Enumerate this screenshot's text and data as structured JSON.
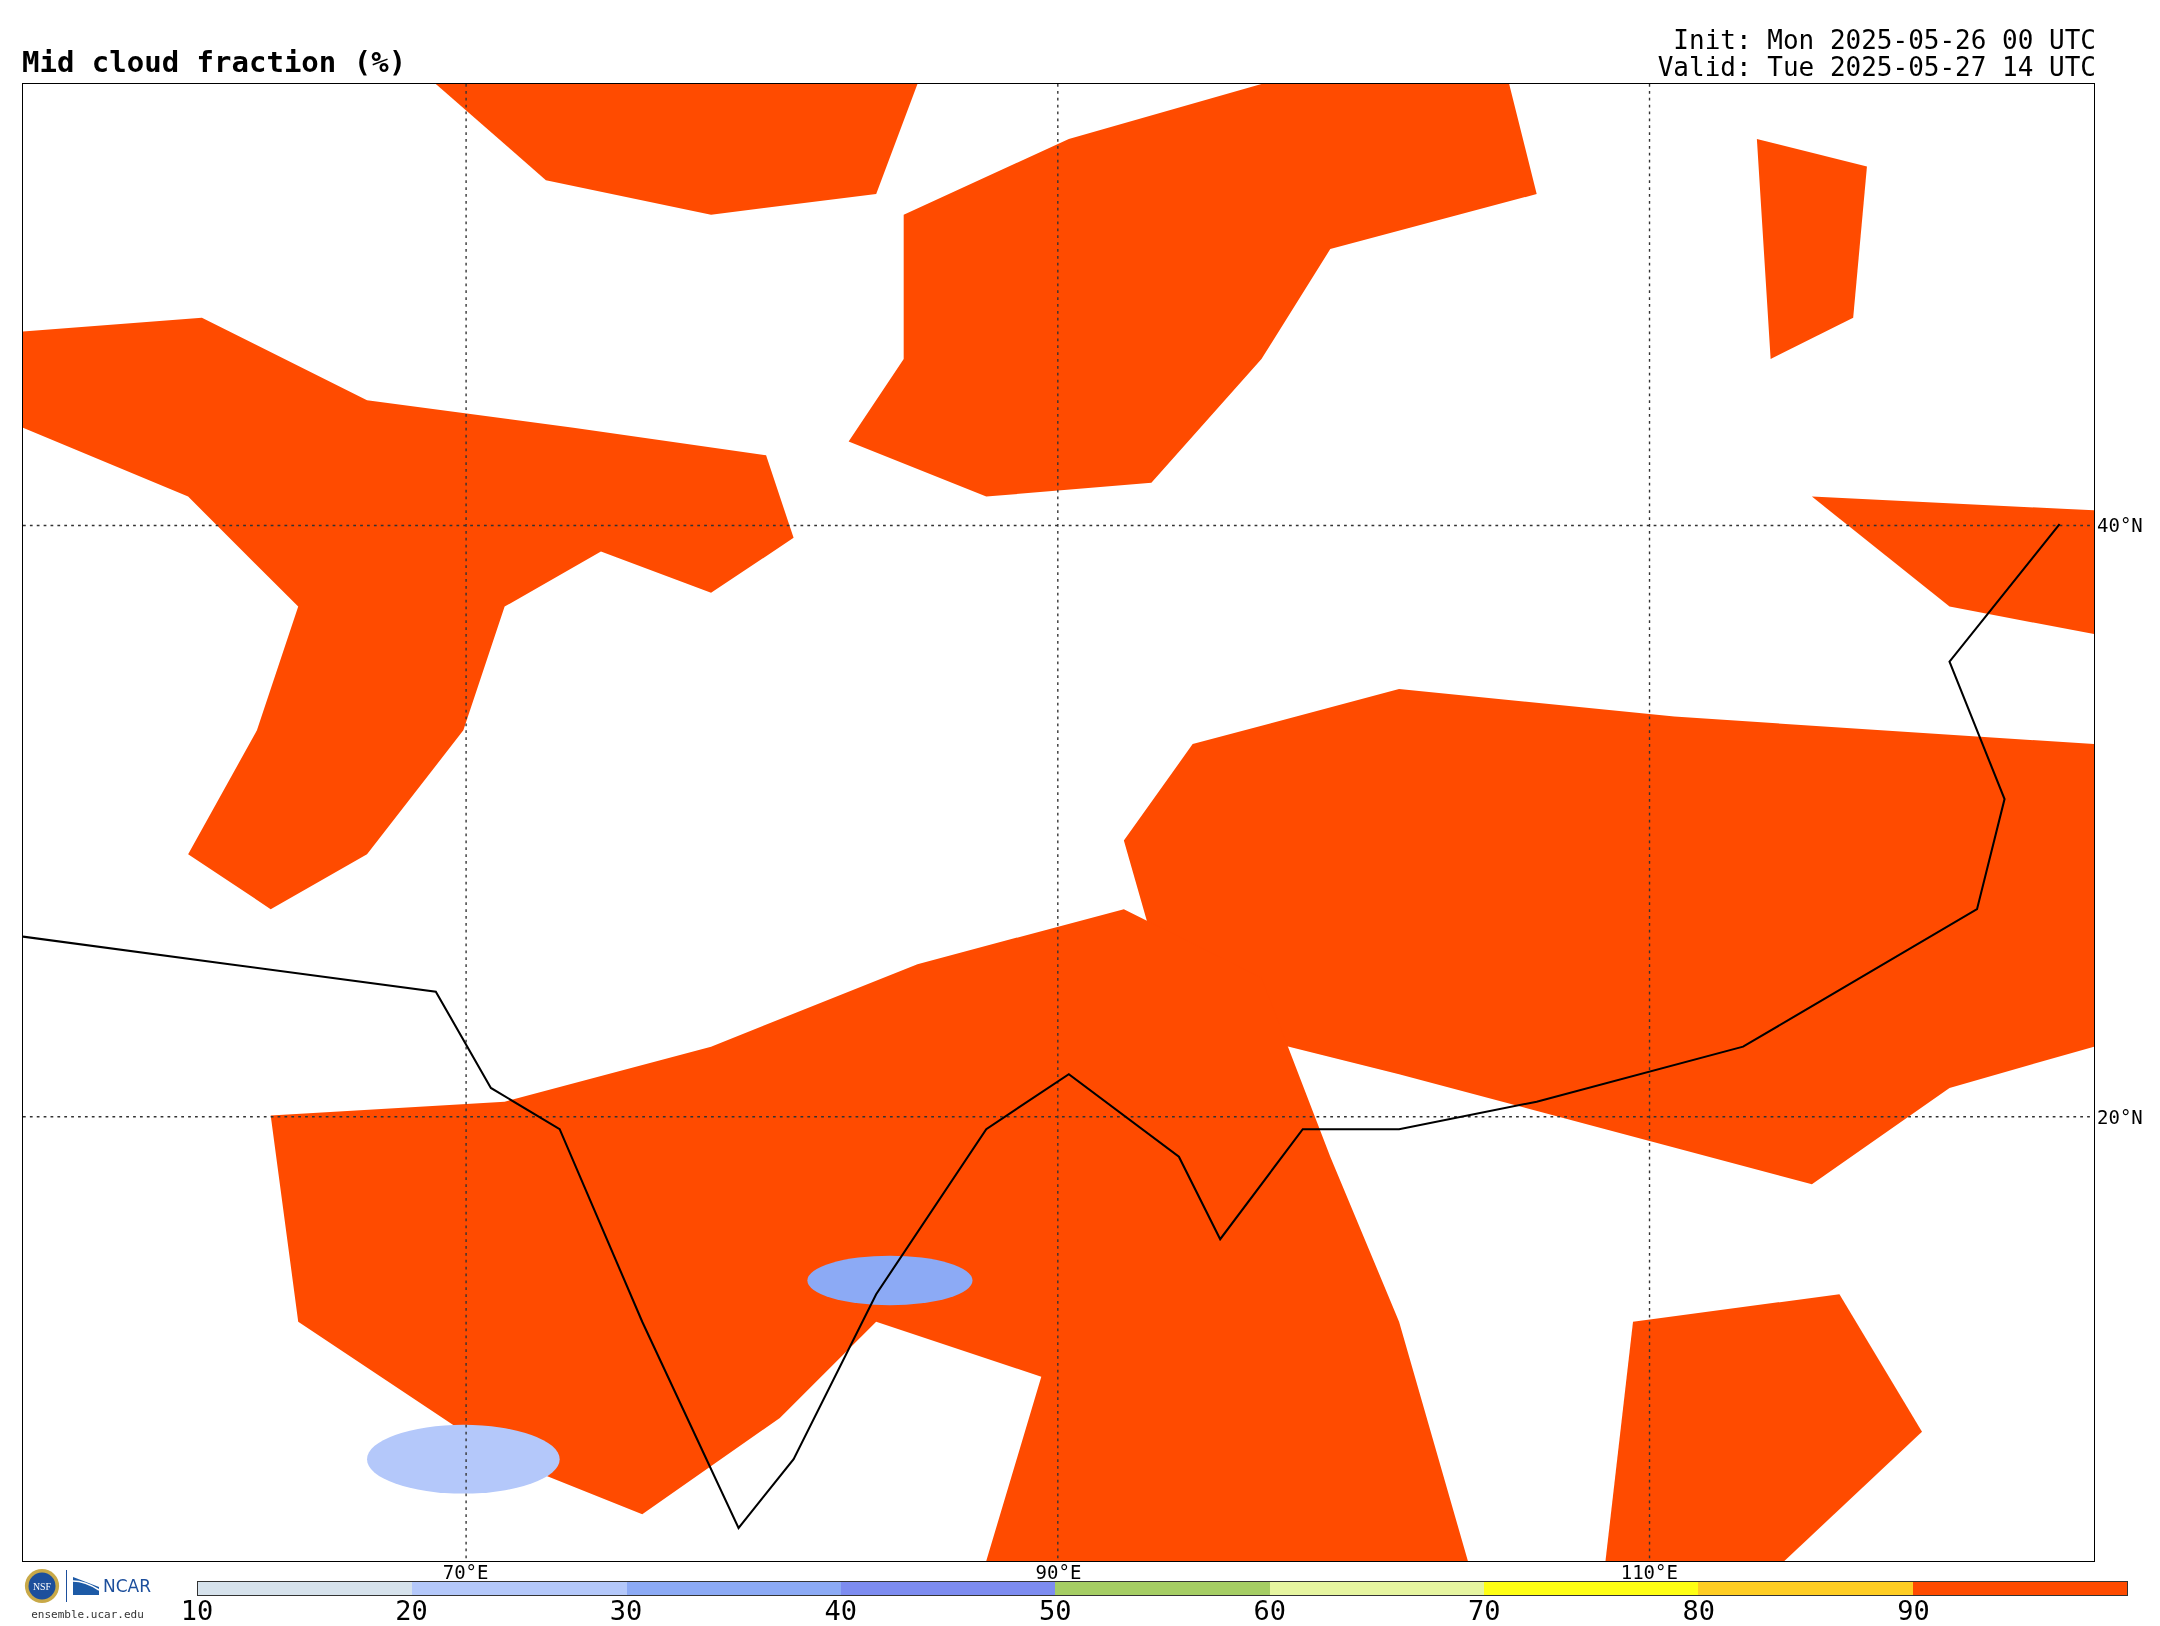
{
  "title": "Mid cloud fraction (%)",
  "init": "Init: Mon 2025-05-26 00 UTC",
  "valid": "Valid: Tue 2025-05-27 14 UTC",
  "map": {
    "lat_labels": [
      "40°N",
      "20°N"
    ],
    "lon_labels": [
      "70°E",
      "90°E",
      "110°E"
    ]
  },
  "logos": {
    "nsf": "NSF",
    "ncar": "NCAR",
    "site": "ensemble.ucar.edu"
  },
  "colorbar": {
    "segments": [
      {
        "color": "#d6e2ec"
      },
      {
        "color": "#b4c8fa"
      },
      {
        "color": "#8caaf5"
      },
      {
        "color": "#7d8cf0"
      },
      {
        "color": "#a5cd64"
      },
      {
        "color": "#e6f5a0"
      },
      {
        "color": "#ffff14"
      },
      {
        "color": "#ffcd23"
      },
      {
        "color": "#ff4b00"
      }
    ],
    "ticks": [
      "10",
      "20",
      "30",
      "40",
      "50",
      "60",
      "70",
      "80",
      "90"
    ]
  }
}
